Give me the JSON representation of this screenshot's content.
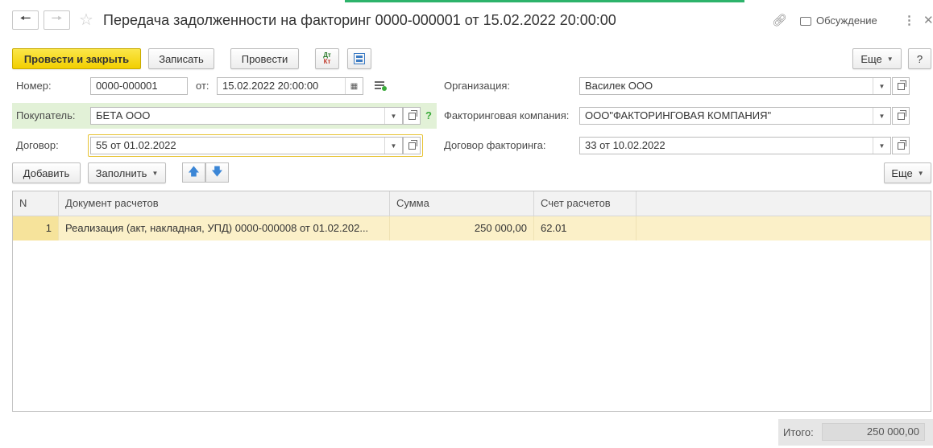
{
  "header": {
    "back_icon": "arrow-left-icon",
    "forward_icon": "arrow-right-icon",
    "title": "Передача задолженности на факторинг 0000-000001 от 15.02.2022 20:00:00",
    "discussion_label": "Обсуждение"
  },
  "toolbar": {
    "post_close_label": "Провести и закрыть",
    "save_label": "Записать",
    "post_label": "Провести",
    "dtkt_icon": "dt-kt-icon",
    "structure_icon": "structure-icon",
    "more_label": "Еще",
    "help_label": "?"
  },
  "form": {
    "number_label": "Номер:",
    "number_value": "0000-000001",
    "date_label": "от:",
    "date_value": "15.02.2022 20:00:00",
    "org_label": "Организация:",
    "org_value": "Василек ООО",
    "buyer_label": "Покупатель:",
    "buyer_value": "БЕТА ООО",
    "buyer_hint": "?",
    "factor_company_label": "Факторинговая компания:",
    "factor_company_value": "ООО\"ФАКТОРИНГОВАЯ КОМПАНИЯ\"",
    "contract_label": "Договор:",
    "contract_value": "55 от 01.02.2022",
    "factor_contract_label": "Договор факторинга:",
    "factor_contract_value": "33 от 10.02.2022"
  },
  "table_toolbar": {
    "add_label": "Добавить",
    "fill_label": "Заполнить",
    "more_label": "Еще"
  },
  "table": {
    "columns": [
      "N",
      "Документ расчетов",
      "Сумма",
      "Счет расчетов"
    ],
    "rows": [
      {
        "n": "1",
        "document": "Реализация (акт, накладная, УПД) 0000-000008 от 01.02.202...",
        "sum": "250 000,00",
        "account": "62.01"
      }
    ]
  },
  "footer": {
    "total_label": "Итого:",
    "total_value": "250 000,00"
  },
  "colors": {
    "primary_button": "#f4d31a",
    "buyer_band": "#e2f1d7",
    "selected_row": "#fbf0c8",
    "focus_border": "#e7c335",
    "top_accent": "#2db36b"
  }
}
